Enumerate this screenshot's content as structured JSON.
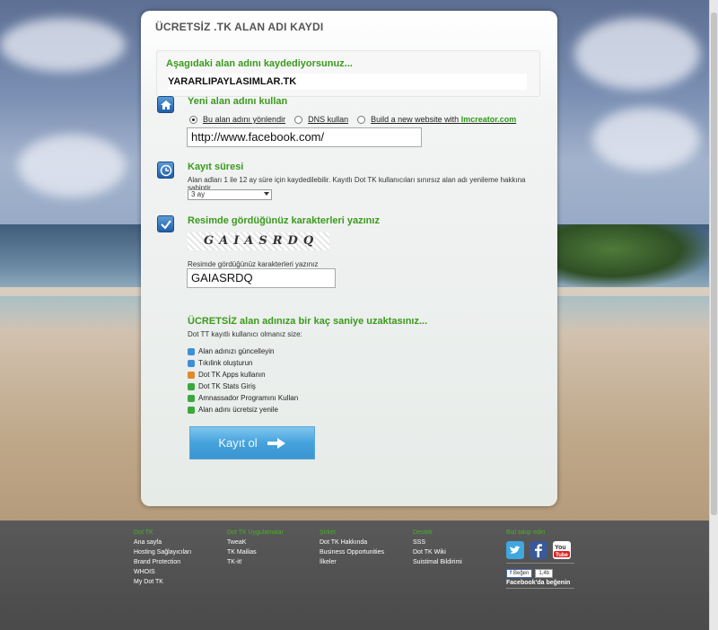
{
  "panel": {
    "title": "ÜCRETSİZ .TK ALAN ADI KAYDI",
    "intro": "Aşagıdaki alan adını kaydediyorsunuz...",
    "domain": "YARARLIPAYLASIMLAR.TK"
  },
  "section_use": {
    "title": "Yeni alan adını kullan",
    "icon": "home-icon",
    "options": {
      "redirect": "Bu alan adını yönlendir",
      "dns": "DNS kullan",
      "build": "Build a new website with",
      "build_brand": "Imcreator.com"
    },
    "selected": "redirect",
    "url_value": "http://www.facebook.com/"
  },
  "section_period": {
    "title": "Kayıt süresi",
    "icon": "clock-icon",
    "description": "Alan adları 1 ile 12 ay süre için kaydedilebilir. Kayıtlı Dot TK kullanıcıları sınırsız alan adı yenileme hakkına sahiptir.",
    "selected_period": "3 ay"
  },
  "section_captcha": {
    "title": "Resimde gördüğünüz karakterleri yazınız",
    "icon": "checkmark-icon",
    "captcha_text": "GAIASRDQ",
    "input_label": "Resimde gördüğünüz karakterleri yazınız",
    "input_value": "GAIASRDQ"
  },
  "offer": {
    "title": "ÜCRETSİZ alan adınıza bir kaç saniye uzaktasınız...",
    "subtitle": "Dot TT kayıtlı kullanıcı olmanız size:",
    "items": [
      {
        "label": "Alan adınızı güncelleyin",
        "color": "#3d8fd6"
      },
      {
        "label": "Tıkılink oluşturun",
        "color": "#3d8fd6"
      },
      {
        "label": "Dot TK Apps kullanın",
        "color": "#e08a2c"
      },
      {
        "label": "Dot TK Stats Giriş",
        "color": "#3ba83b"
      },
      {
        "label": "Amnassador Programını Kullan",
        "color": "#3ba83b"
      },
      {
        "label": "Alan adını ücretsiz yenile",
        "color": "#3ba83b"
      }
    ],
    "submit_label": "Kayıt ol"
  },
  "footer": {
    "col1": {
      "head": "Dot TK",
      "links": [
        "Ana sayfa",
        "Hosting Sağlayıcıları",
        "Brand Protection",
        "WHOIS",
        "My Dot TK"
      ]
    },
    "col2": {
      "head": "Dot TK Uygulamalar",
      "links": [
        "TweaK",
        "TK Mailias",
        "TK-it!"
      ]
    },
    "col3": {
      "head": "Şirket",
      "links": [
        "Dot TK Hakkında",
        "Business Opportunities",
        "İlkeler"
      ]
    },
    "col4": {
      "head": "Destek",
      "links": [
        "SSS",
        "Dot TK Wiki",
        "Suistimal Bildirimi"
      ]
    },
    "social": {
      "head": "Bizi takip edin",
      "like_label": "Beğen",
      "like_count": "1,4b",
      "fb_text": "Facebook'da beğenin"
    }
  },
  "colors": {
    "accent_green": "#3a9a1c",
    "button_blue": "#46a3dc",
    "footer_bg": "#595959"
  }
}
